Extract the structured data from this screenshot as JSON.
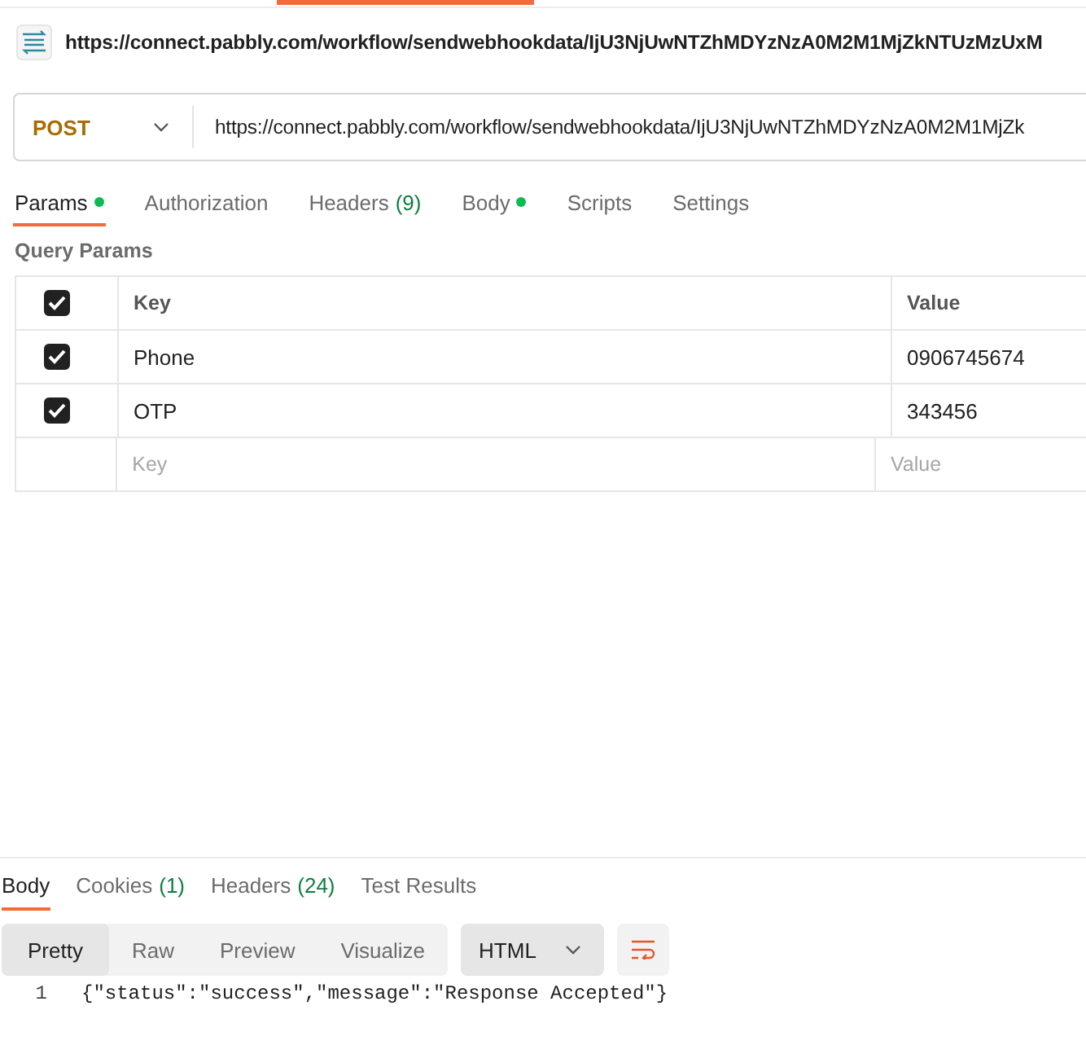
{
  "request_title": "https://connect.pabbly.com/workflow/sendwebhookdata/IjU3NjUwNTZhMDYzNzA0M2M1MjZkNTUzMzUxM",
  "method": "POST",
  "url": "https://connect.pabbly.com/workflow/sendwebhookdata/IjU3NjUwNTZhMDYzNzA0M2M1MjZk",
  "request_tabs": [
    {
      "label": "Params",
      "dot": true,
      "selected": true
    },
    {
      "label": "Authorization",
      "dot": false,
      "selected": false
    },
    {
      "label": "Headers",
      "count": "(9)",
      "dot": false,
      "selected": false
    },
    {
      "label": "Body",
      "dot": true,
      "selected": false
    },
    {
      "label": "Scripts",
      "dot": false,
      "selected": false
    },
    {
      "label": "Settings",
      "dot": false,
      "selected": false
    }
  ],
  "query_params": {
    "title": "Query Params",
    "header": {
      "checked": true,
      "key": "Key",
      "value": "Value"
    },
    "rows": [
      {
        "checked": true,
        "key": "Phone",
        "value": "0906745674"
      },
      {
        "checked": true,
        "key": "OTP",
        "value": "343456"
      }
    ],
    "new_row": {
      "key_placeholder": "Key",
      "value_placeholder": "Value"
    }
  },
  "response_tabs": [
    {
      "label": "Body",
      "selected": true
    },
    {
      "label": "Cookies",
      "count": "(1)",
      "selected": false
    },
    {
      "label": "Headers",
      "count": "(24)",
      "selected": false
    },
    {
      "label": "Test Results",
      "selected": false
    }
  ],
  "view_modes": [
    {
      "label": "Pretty",
      "selected": true
    },
    {
      "label": "Raw",
      "selected": false
    },
    {
      "label": "Preview",
      "selected": false
    },
    {
      "label": "Visualize",
      "selected": false
    }
  ],
  "format": "HTML",
  "code_lines": [
    {
      "number": "1",
      "text": "{\"status\":\"success\",\"message\":\"Response Accepted\"}"
    }
  ]
}
